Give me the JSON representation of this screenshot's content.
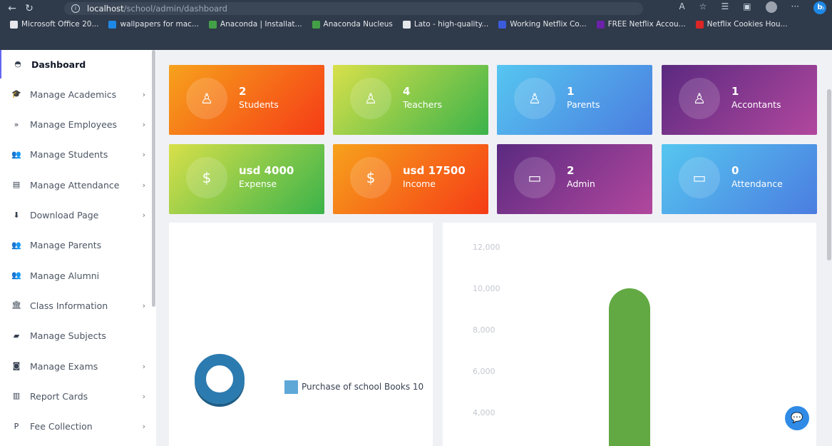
{
  "browser": {
    "url_host": "localhost",
    "url_path": "/school/admin/dashboard",
    "bookmarks": [
      {
        "label": "Microsoft Office 20...",
        "color": "#e5e7eb"
      },
      {
        "label": "wallpapers for mac...",
        "color": "#1e88e5"
      },
      {
        "label": "Anaconda | Installat...",
        "color": "#43a047"
      },
      {
        "label": "Anaconda Nucleus",
        "color": "#43a047"
      },
      {
        "label": "Lato - high-quality...",
        "color": "#e5e7eb"
      },
      {
        "label": "Working Netflix Co...",
        "color": "#3b5bdb"
      },
      {
        "label": "FREE Netflix Accou...",
        "color": "#6b21a8"
      },
      {
        "label": "Netflix Cookies Hou...",
        "color": "#dc2626"
      }
    ]
  },
  "sidebar": {
    "items": [
      {
        "label": "Dashboard",
        "icon": "dashboard-icon",
        "chevron": false,
        "active": true
      },
      {
        "label": "Manage Academics",
        "icon": "graduation-cap-icon",
        "chevron": true
      },
      {
        "label": "Manage Employees",
        "icon": "double-angle-icon",
        "chevron": true
      },
      {
        "label": "Manage Students",
        "icon": "users-icon",
        "chevron": true
      },
      {
        "label": "Manage Attendance",
        "icon": "clipboard-icon",
        "chevron": true
      },
      {
        "label": "Download Page",
        "icon": "download-icon",
        "chevron": true
      },
      {
        "label": "Manage Parents",
        "icon": "users-icon",
        "chevron": false
      },
      {
        "label": "Manage Alumni",
        "icon": "users-icon",
        "chevron": false
      },
      {
        "label": "Class Information",
        "icon": "bank-icon",
        "chevron": true
      },
      {
        "label": "Manage Subjects",
        "icon": "book-icon",
        "chevron": false
      },
      {
        "label": "Manage Exams",
        "icon": "camera-icon",
        "chevron": true
      },
      {
        "label": "Report Cards",
        "icon": "bar-chart-icon",
        "chevron": true
      },
      {
        "label": "Fee Collection",
        "icon": "paypal-icon",
        "chevron": true
      }
    ]
  },
  "cards": [
    {
      "value": "2",
      "label": "Students",
      "icon": "user-icon",
      "gradient": [
        "#f7a21c",
        "#f53c16"
      ]
    },
    {
      "value": "4",
      "label": "Teachers",
      "icon": "user-icon",
      "gradient": [
        "#d8e04a",
        "#3bb34a"
      ]
    },
    {
      "value": "1",
      "label": "Parents",
      "icon": "user-icon",
      "gradient": [
        "#56c6f0",
        "#4b7de0"
      ]
    },
    {
      "value": "1",
      "label": "Accontants",
      "icon": "user-icon",
      "gradient": [
        "#5a2a80",
        "#b2479e"
      ]
    },
    {
      "value": "usd 4000",
      "label": "Expense",
      "icon": "dollar-icon",
      "gradient": [
        "#d8e04a",
        "#3bb34a"
      ]
    },
    {
      "value": "usd 17500",
      "label": "Income",
      "icon": "dollar-icon",
      "gradient": [
        "#f7a21c",
        "#f53c16"
      ]
    },
    {
      "value": "2",
      "label": "Admin",
      "icon": "wallet-icon",
      "gradient": [
        "#5a2a80",
        "#b2479e"
      ]
    },
    {
      "value": "0",
      "label": "Attendance",
      "icon": "wallet-icon",
      "gradient": [
        "#56c6f0",
        "#4b7de0"
      ]
    }
  ],
  "donut_panel": {
    "legend_label": "Purchase of school Books 10",
    "ring_color": "#2b7bb0",
    "swatch_color": "#5ea8d8"
  },
  "chart_data": {
    "type": "bar",
    "y_ticks": [
      "12,000",
      "10,000",
      "8,000",
      "6,000",
      "4,000"
    ],
    "values": [
      10000
    ],
    "ylim": [
      0,
      12000
    ],
    "bar_color": "#62a944"
  }
}
